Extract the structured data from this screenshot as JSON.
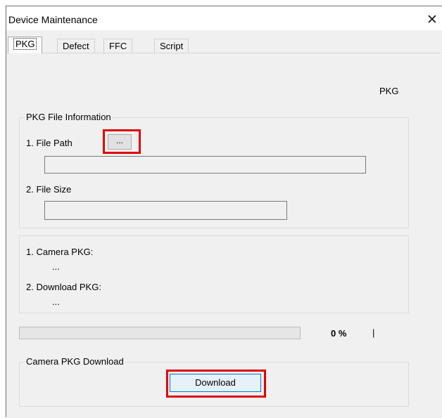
{
  "window": {
    "title": "Device Maintenance",
    "close_glyph": "✕"
  },
  "tabs": [
    {
      "label": "PKG",
      "active": true
    },
    {
      "label": "Defect",
      "active": false
    },
    {
      "label": "FFC",
      "active": false
    },
    {
      "label": "Script",
      "active": false
    }
  ],
  "panel": {
    "heading": "PKG",
    "file_info": {
      "group_title": "PKG File Information",
      "file_path_label": "1. File Path",
      "browse_button_label": "...",
      "file_path_value": "",
      "file_size_label": "2. File Size",
      "file_size_value": ""
    },
    "versions": {
      "camera_pkg_label": "1. Camera PKG:",
      "camera_pkg_value": "...",
      "download_pkg_label": "2. Download PKG:",
      "download_pkg_value": "..."
    },
    "progress": {
      "percent": 0,
      "percent_text": "0 %",
      "separator": "|"
    },
    "download": {
      "group_title": "Camera PKG Download",
      "button_label": "Download"
    }
  },
  "colors": {
    "highlight_box": "#e00000",
    "focus_border": "#0078d7"
  },
  "icons": {
    "close": "close-icon"
  }
}
